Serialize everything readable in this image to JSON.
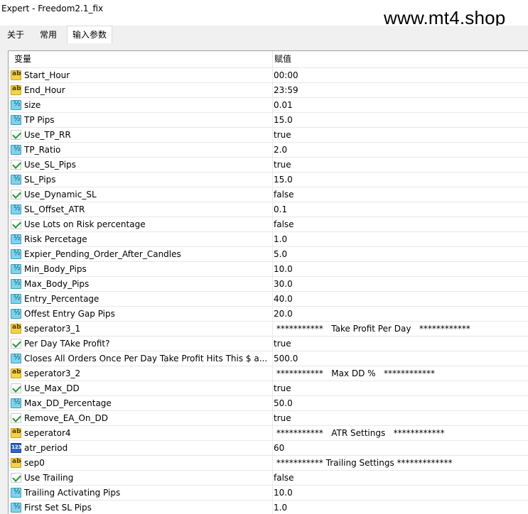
{
  "window": {
    "title": "Expert - Freedom2.1_fix"
  },
  "watermark": "www.mt4.shop",
  "tabs": [
    {
      "label": "关于"
    },
    {
      "label": "常用"
    },
    {
      "label": "输入参数",
      "active": true
    }
  ],
  "table": {
    "headers": {
      "variable": "变量",
      "value": "赋值"
    },
    "rows": [
      {
        "icon": "ab",
        "name": "Start_Hour",
        "value": "00:00"
      },
      {
        "icon": "ab",
        "name": "End_Hour",
        "value": "23:59"
      },
      {
        "icon": "num",
        "name": "size",
        "value": "0.01"
      },
      {
        "icon": "num",
        "name": "TP Pips",
        "value": "15.0"
      },
      {
        "icon": "bool",
        "name": "Use_TP_RR",
        "value": "true"
      },
      {
        "icon": "num",
        "name": "TP_Ratio",
        "value": "2.0"
      },
      {
        "icon": "bool",
        "name": "Use_SL_Pips",
        "value": "true"
      },
      {
        "icon": "num",
        "name": "SL_Pips",
        "value": "15.0"
      },
      {
        "icon": "bool",
        "name": "Use_Dynamic_SL",
        "value": "false"
      },
      {
        "icon": "num",
        "name": "SL_Offset_ATR",
        "value": "0.1"
      },
      {
        "icon": "bool",
        "name": "Use Lots on Risk percentage",
        "value": "false"
      },
      {
        "icon": "num",
        "name": "Risk Percetage",
        "value": "1.0"
      },
      {
        "icon": "num",
        "name": "Expier_Pending_Order_After_Candles",
        "value": "5.0"
      },
      {
        "icon": "num",
        "name": "Min_Body_Pips",
        "value": "10.0"
      },
      {
        "icon": "num",
        "name": "Max_Body_Pips",
        "value": "30.0"
      },
      {
        "icon": "num",
        "name": "Entry_Percentage",
        "value": "40.0"
      },
      {
        "icon": "num",
        "name": "Offest Entry Gap Pips",
        "value": "20.0"
      },
      {
        "icon": "ab",
        "name": "seperator3_1",
        "value": " ***********   Take Profit Per Day   ************"
      },
      {
        "icon": "bool",
        "name": "Per Day TAke Profit?",
        "value": "true"
      },
      {
        "icon": "num",
        "name": "Closes All Orders Once Per Day Take Profit Hits This $ a...",
        "value": "500.0"
      },
      {
        "icon": "ab",
        "name": "seperator3_2",
        "value": " ***********   Max DD %   ************"
      },
      {
        "icon": "bool",
        "name": "Use_Max_DD",
        "value": "true"
      },
      {
        "icon": "num",
        "name": "Max_DD_Percentage",
        "value": "50.0"
      },
      {
        "icon": "bool",
        "name": "Remove_EA_On_DD",
        "value": "true"
      },
      {
        "icon": "ab",
        "name": "seperator4",
        "value": " ***********   ATR Settings   ************"
      },
      {
        "icon": "int",
        "name": "atr_period",
        "value": "60"
      },
      {
        "icon": "ab",
        "name": "sep0",
        "value": " *********** Trailing Settings *************"
      },
      {
        "icon": "bool",
        "name": "Use Trailing",
        "value": "false"
      },
      {
        "icon": "num",
        "name": "Trailing Activating Pips",
        "value": "10.0"
      },
      {
        "icon": "num",
        "name": "First Set SL  Pips",
        "value": "1.0"
      }
    ]
  }
}
